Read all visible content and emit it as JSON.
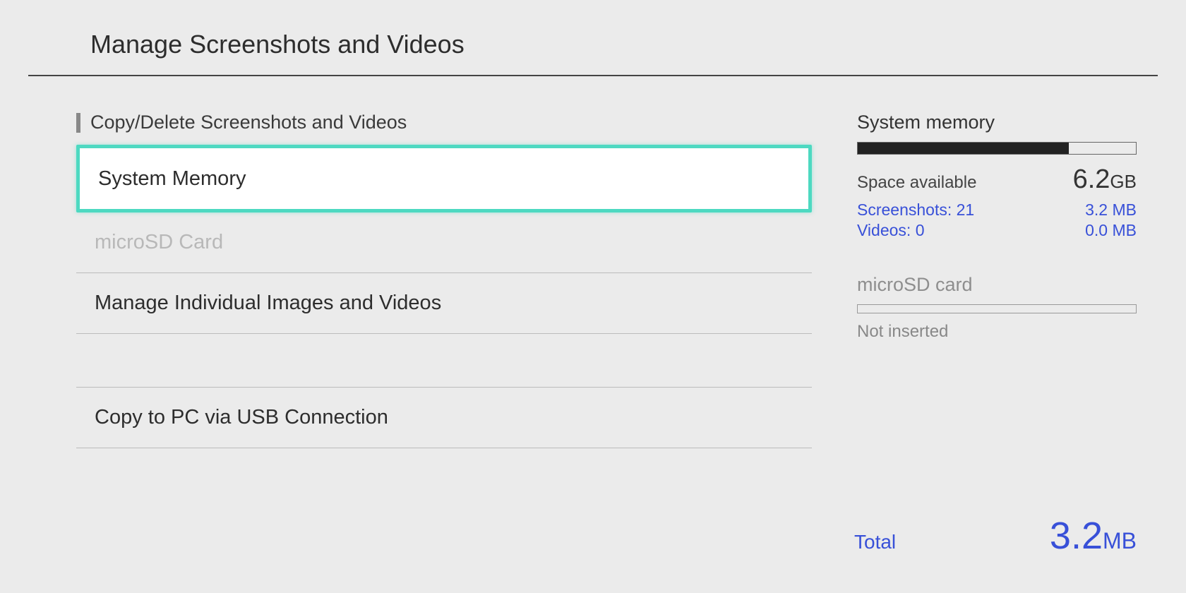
{
  "header": {
    "title": "Manage Screenshots and Videos"
  },
  "section": {
    "label": "Copy/Delete Screenshots and Videos"
  },
  "menu": {
    "system_memory": "System Memory",
    "microsd_card": "microSD Card",
    "manage_individual": "Manage Individual Images and Videos",
    "copy_to_pc": "Copy to PC via USB Connection"
  },
  "storage": {
    "system_memory": {
      "title": "System memory",
      "space_label": "Space available",
      "space_value": "6.2",
      "space_unit": "GB",
      "screenshots_label": "Screenshots: 21",
      "screenshots_size": "3.2 MB",
      "videos_label": "Videos: 0",
      "videos_size": "0.0 MB"
    },
    "microsd": {
      "title": "microSD card",
      "status": "Not inserted"
    }
  },
  "total": {
    "label": "Total",
    "value": "3.2",
    "unit": "MB"
  }
}
